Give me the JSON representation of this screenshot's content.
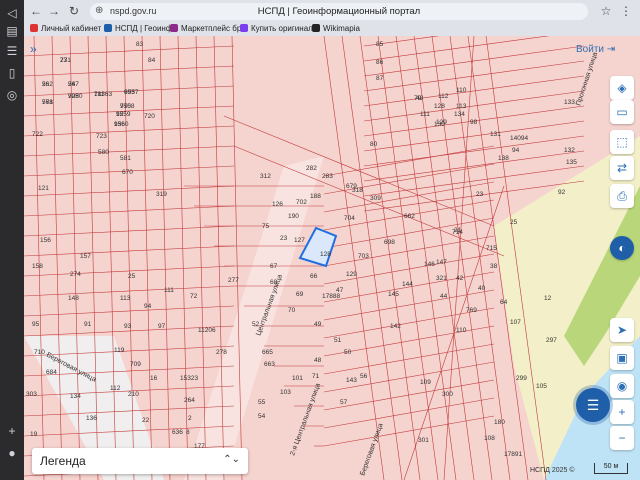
{
  "browser": {
    "url": "nspd.gov.ru",
    "page_title": "НСПД | Геоинформационный портал",
    "bookmarks": [
      {
        "label": "Личный кабинет",
        "color": "#d33"
      },
      {
        "label": "НСПД | Геоинфо",
        "color": "#1f5ea8"
      },
      {
        "label": "Маркетплейс бра",
        "color": "#8b2a8b"
      },
      {
        "label": "Купить оригинал",
        "color": "#7a3df0"
      },
      {
        "label": "Wikimapia",
        "color": "#222"
      }
    ]
  },
  "map": {
    "login_label": "Войти",
    "legend_label": "Легенда",
    "copyright": "НСПД 2025 ©",
    "scale_label": "50 м",
    "colors": {
      "parcel_fill": "#f5d3cf",
      "parcel_line": "#c23b3b",
      "selected": "#1f6fe0",
      "river": "#bfe3f6",
      "forest": "#d6e8a8",
      "sand": "#f3efc8"
    },
    "parcel_labels": [
      "731",
      "562",
      "567",
      "568",
      "9250",
      "18363",
      "9557",
      "9558",
      "9559",
      "9560",
      "720",
      "722",
      "723",
      "580",
      "581",
      "670",
      "121",
      "319",
      "312",
      "282",
      "283",
      "679",
      "318",
      "309",
      "702",
      "188",
      "126",
      "190",
      "75",
      "23",
      "127",
      "128",
      "704",
      "662",
      "698",
      "703",
      "129",
      "66",
      "67",
      "68",
      "69",
      "277",
      "70",
      "47",
      "49",
      "52",
      "50",
      "51",
      "17888",
      "48",
      "71",
      "72",
      "11206",
      "278",
      "665",
      "663",
      "101",
      "103",
      "55",
      "54",
      "57",
      "56",
      "143",
      "142",
      "145",
      "144",
      "146",
      "147",
      "321",
      "44",
      "42",
      "714",
      "715",
      "38",
      "40",
      "64",
      "12",
      "769",
      "110",
      "107",
      "297",
      "299",
      "105",
      "109",
      "300",
      "301",
      "108",
      "180",
      "17891",
      "303",
      "156",
      "157",
      "158",
      "274",
      "25",
      "148",
      "113",
      "95",
      "91",
      "111",
      "94",
      "97",
      "93",
      "119",
      "112",
      "709",
      "710",
      "684",
      "210",
      "16",
      "134",
      "136",
      "19",
      "22",
      "15323",
      "264",
      "2",
      "8",
      "636",
      "177",
      "81",
      "82",
      "83",
      "84",
      "85",
      "86",
      "87",
      "80",
      "79",
      "43",
      "128",
      "129",
      "130",
      "131",
      "14094",
      "138",
      "98",
      "94",
      "110",
      "111",
      "112",
      "113",
      "134",
      "135",
      "132",
      "133",
      "92",
      "25",
      "21",
      "23",
      "27",
      "26",
      "24",
      "771",
      "708",
      "711",
      "693",
      "770",
      "12",
      "136"
    ],
    "street_labels": [
      "Береговая улица",
      "Центральная улица",
      "2-я Центральная улица",
      "Прогонная улица",
      "Береговая улица"
    ]
  }
}
